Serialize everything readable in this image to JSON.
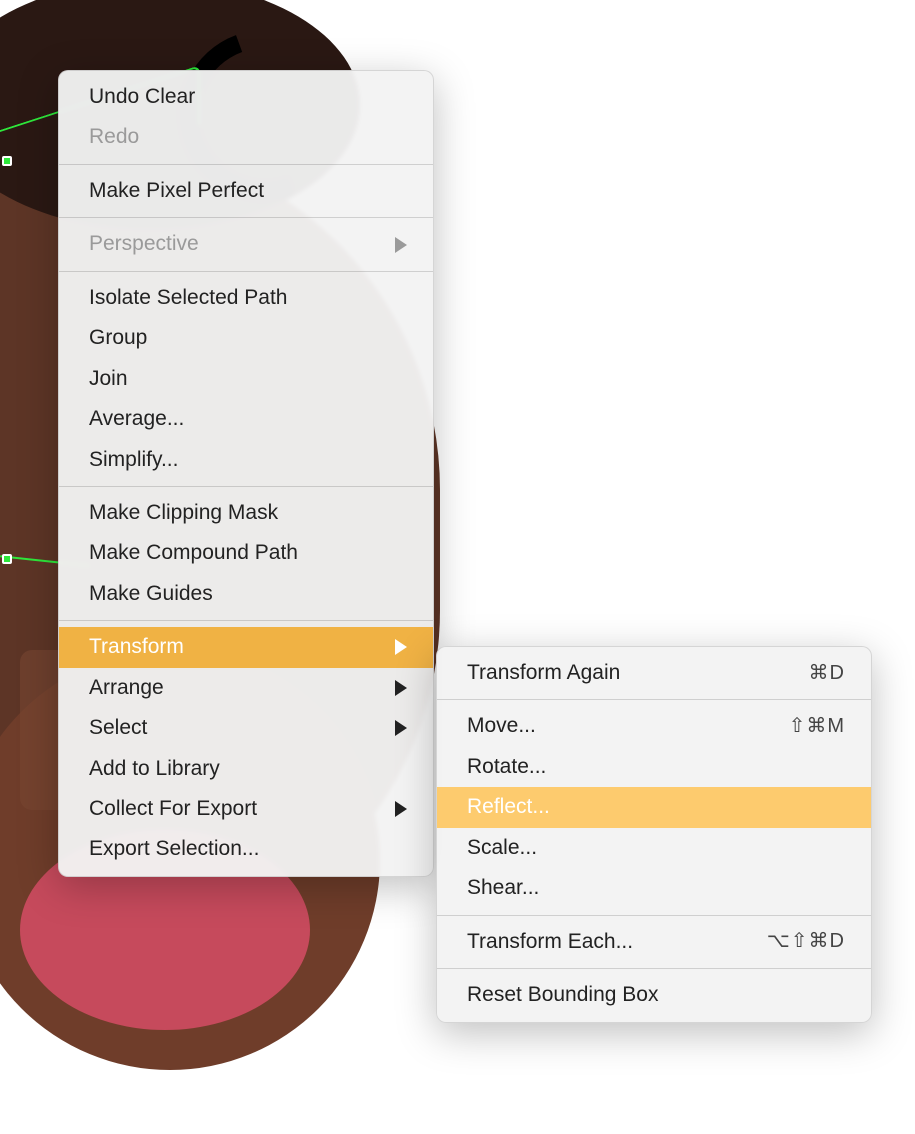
{
  "mainMenu": {
    "undo": "Undo Clear",
    "redo": "Redo",
    "make_pixel_perfect": "Make Pixel Perfect",
    "perspective": "Perspective",
    "isolate": "Isolate Selected Path",
    "group": "Group",
    "join": "Join",
    "average": "Average...",
    "simplify": "Simplify...",
    "make_clipping_mask": "Make Clipping Mask",
    "make_compound_path": "Make Compound Path",
    "make_guides": "Make Guides",
    "transform": "Transform",
    "arrange": "Arrange",
    "select": "Select",
    "add_to_library": "Add to Library",
    "collect_for_export": "Collect For Export",
    "export_selection": "Export Selection..."
  },
  "subMenu": {
    "transform_again": {
      "label": "Transform Again",
      "shortcut": "⌘D"
    },
    "move": {
      "label": "Move...",
      "shortcut": "⇧⌘M"
    },
    "rotate": {
      "label": "Rotate..."
    },
    "reflect": {
      "label": "Reflect..."
    },
    "scale": {
      "label": "Scale..."
    },
    "shear": {
      "label": "Shear..."
    },
    "transform_each": {
      "label": "Transform Each...",
      "shortcut": "⌥⇧⌘D"
    },
    "reset_bounding_box": {
      "label": "Reset Bounding Box"
    }
  }
}
